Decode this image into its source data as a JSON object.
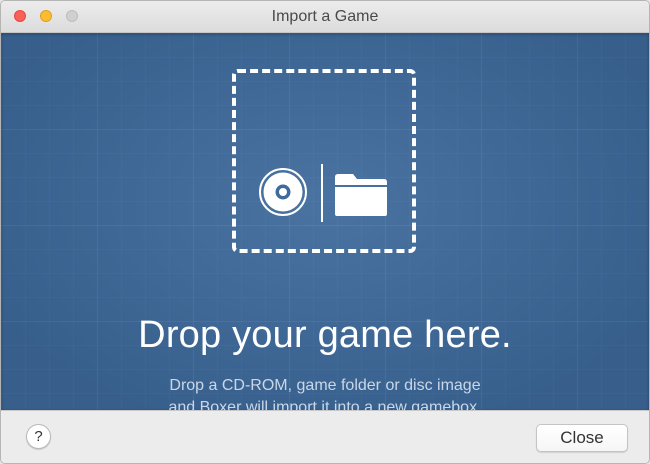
{
  "window": {
    "title": "Import a Game"
  },
  "drop_area": {
    "icons": [
      "disc-icon",
      "folder-icon"
    ],
    "headline": "Drop your game here.",
    "subtext_line1": "Drop a CD-ROM, game folder or disc image",
    "subtext_line2": "and Boxer will import it into a new gamebox.",
    "background_color": "#3e6a9c"
  },
  "footer": {
    "help_label": "?",
    "close_label": "Close"
  }
}
